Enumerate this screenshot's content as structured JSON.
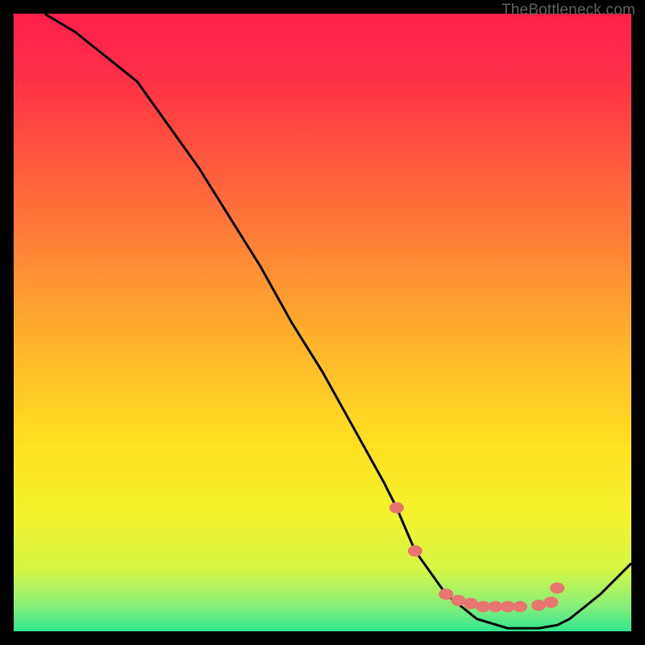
{
  "attribution": "TheBottleneck.com",
  "chart_data": {
    "type": "line",
    "title": "",
    "xlabel": "",
    "ylabel": "",
    "xlim": [
      0,
      100
    ],
    "ylim": [
      0,
      100
    ],
    "curve": {
      "x": [
        5,
        10,
        15,
        20,
        25,
        30,
        35,
        40,
        45,
        50,
        55,
        60,
        62,
        65,
        70,
        75,
        80,
        82,
        85,
        88,
        90,
        95,
        100
      ],
      "y": [
        100,
        97,
        93,
        89,
        82,
        75,
        67,
        59,
        50,
        42,
        33,
        24,
        20,
        13,
        6,
        2,
        0.5,
        0.5,
        0.5,
        1,
        2,
        6,
        11
      ]
    },
    "markers": {
      "x": [
        62,
        65,
        70,
        72,
        74,
        76,
        78,
        80,
        82,
        85,
        87,
        88
      ],
      "y": [
        20,
        13,
        6,
        5,
        4.5,
        4,
        4,
        4,
        4,
        4.2,
        4.7,
        7
      ]
    },
    "gradient_stops": [
      {
        "offset": 0.0,
        "color": "#ff1f4b"
      },
      {
        "offset": 0.1,
        "color": "#ff2f46"
      },
      {
        "offset": 0.25,
        "color": "#ff5c3d"
      },
      {
        "offset": 0.4,
        "color": "#ff8a34"
      },
      {
        "offset": 0.55,
        "color": "#ffb82a"
      },
      {
        "offset": 0.7,
        "color": "#ffe120"
      },
      {
        "offset": 0.8,
        "color": "#f6f22a"
      },
      {
        "offset": 0.9,
        "color": "#d6f646"
      },
      {
        "offset": 0.96,
        "color": "#86ef7a"
      },
      {
        "offset": 1.0,
        "color": "#2fe591"
      }
    ],
    "marker_color": "#e6766e",
    "curve_color": "#000000"
  }
}
